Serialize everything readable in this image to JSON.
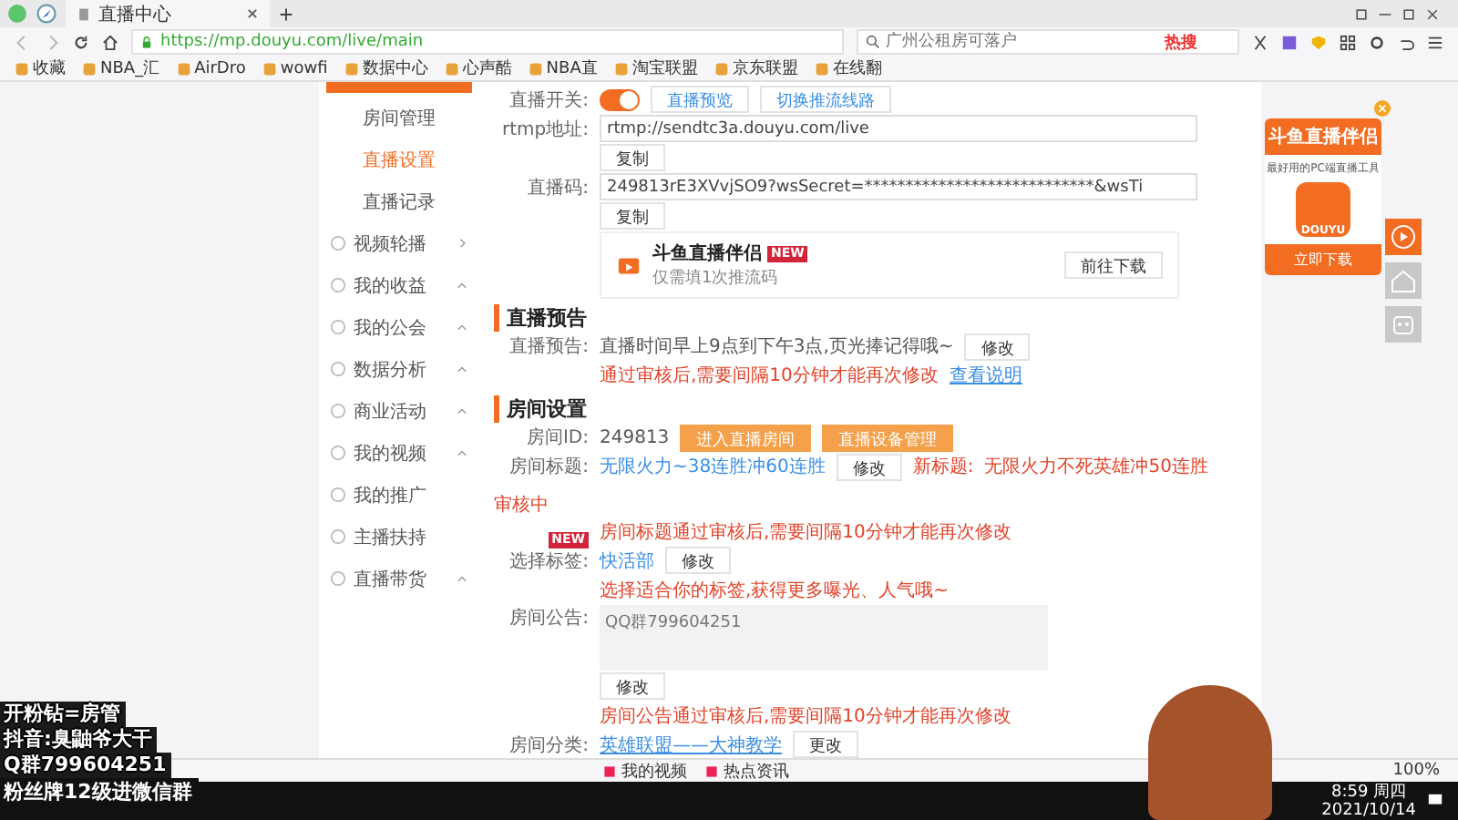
{
  "browser": {
    "tab_title": "直播中心",
    "url": "https://mp.douyu.com/live/main",
    "search_placeholder": "广州公租房可落户",
    "hot_label": "热搜",
    "bookmarks": [
      "收藏",
      "NBA_汇",
      "AirDro",
      "wowfi",
      "数据中心",
      "心声酷",
      "NBA直",
      "淘宝联盟",
      "京东联盟",
      "在线翻"
    ]
  },
  "sidebar": {
    "items": [
      {
        "label": "房间管理",
        "kind": "sub",
        "expanded": false,
        "selected": false
      },
      {
        "label": "直播设置",
        "kind": "sub",
        "expanded": false,
        "selected": true
      },
      {
        "label": "直播记录",
        "kind": "sub",
        "expanded": false,
        "selected": false
      },
      {
        "label": "视频轮播",
        "kind": "group",
        "expanded": false,
        "selected": false
      },
      {
        "label": "我的收益",
        "kind": "group",
        "expanded": true,
        "selected": false
      },
      {
        "label": "我的公会",
        "kind": "group",
        "expanded": true,
        "selected": false
      },
      {
        "label": "数据分析",
        "kind": "group",
        "expanded": true,
        "selected": false
      },
      {
        "label": "商业活动",
        "kind": "group",
        "expanded": true,
        "selected": false
      },
      {
        "label": "我的视频",
        "kind": "group",
        "expanded": true,
        "selected": false
      },
      {
        "label": "我的推广",
        "kind": "link",
        "expanded": false,
        "selected": false
      },
      {
        "label": "主播扶持",
        "kind": "link",
        "expanded": false,
        "selected": false
      },
      {
        "label": "直播带货",
        "kind": "group",
        "expanded": true,
        "selected": false
      }
    ]
  },
  "stream_settings": {
    "switch_label": "直播开关:",
    "switch_on": true,
    "links": [
      "直播预览",
      "切换推流线路"
    ],
    "fields": [
      {
        "label": "rtmp地址:",
        "value": "rtmp://sendtc3a.douyu.com/live",
        "button": "复制"
      },
      {
        "label": "直播码:",
        "value": "249813rE3XVvjSO9?wsSecret=****************************&wsTi",
        "button": "复制"
      }
    ]
  },
  "promo_card": {
    "title": "斗鱼直播伴侣",
    "badge": "NEW",
    "subtitle": "仅需填1次推流码",
    "button": "前往下载"
  },
  "notice_section": {
    "heading": "直播预告",
    "label": "直播预告:",
    "value": "直播时间早上9点到下午3点,页光捧记得哦~",
    "button": "修改",
    "note": "通过审核后,需要间隔10分钟才能再次修改",
    "link": "查看说明"
  },
  "room_section": {
    "heading": "房间设置",
    "id_label": "房间ID:",
    "id_value": "249813",
    "id_buttons": [
      "进入直播房间",
      "直播设备管理"
    ],
    "title_label": "房间标题:",
    "title_value": "无限火力~38连胜冲60连胜",
    "title_button": "修改",
    "new_title_label": "新标题:",
    "new_title_value": "无限火力不死英雄冲50连胜",
    "new_title_status": "审核中",
    "title_note": "房间标题通过审核后,需要间隔10分钟才能再次修改",
    "tag_label": "选择标签:",
    "tag_badge": "NEW",
    "tag_value": "快活部",
    "tag_button": "修改",
    "tag_note": "选择适合你的标签,获得更多曝光、人气哦~",
    "notice_label": "房间公告:",
    "notice_value": "QQ群799604251",
    "notice_button": "修改",
    "notice_note": "房间公告通过审核后,需要间隔10分钟才能再次修改",
    "category_label": "房间分类:",
    "category_value": "英雄联盟——大神教学",
    "category_button": "更改"
  },
  "side_widget": {
    "title": "斗鱼直播伴侣",
    "subtitle": "最好用的PC端直播工具",
    "app_label": "DOUYU",
    "button": "立即下载"
  },
  "status_bar": {
    "items": [
      "我的视频",
      "热点资讯"
    ],
    "zoom": "100%"
  },
  "taskbar": {
    "time": "8:59 周四",
    "date": "2021/10/14"
  },
  "stream_overlay": {
    "lines": [
      "开粉钻=房管",
      "抖音:臭鼬爷大干",
      "Q群799604251"
    ],
    "banner": "粉丝牌12级进微信群"
  }
}
